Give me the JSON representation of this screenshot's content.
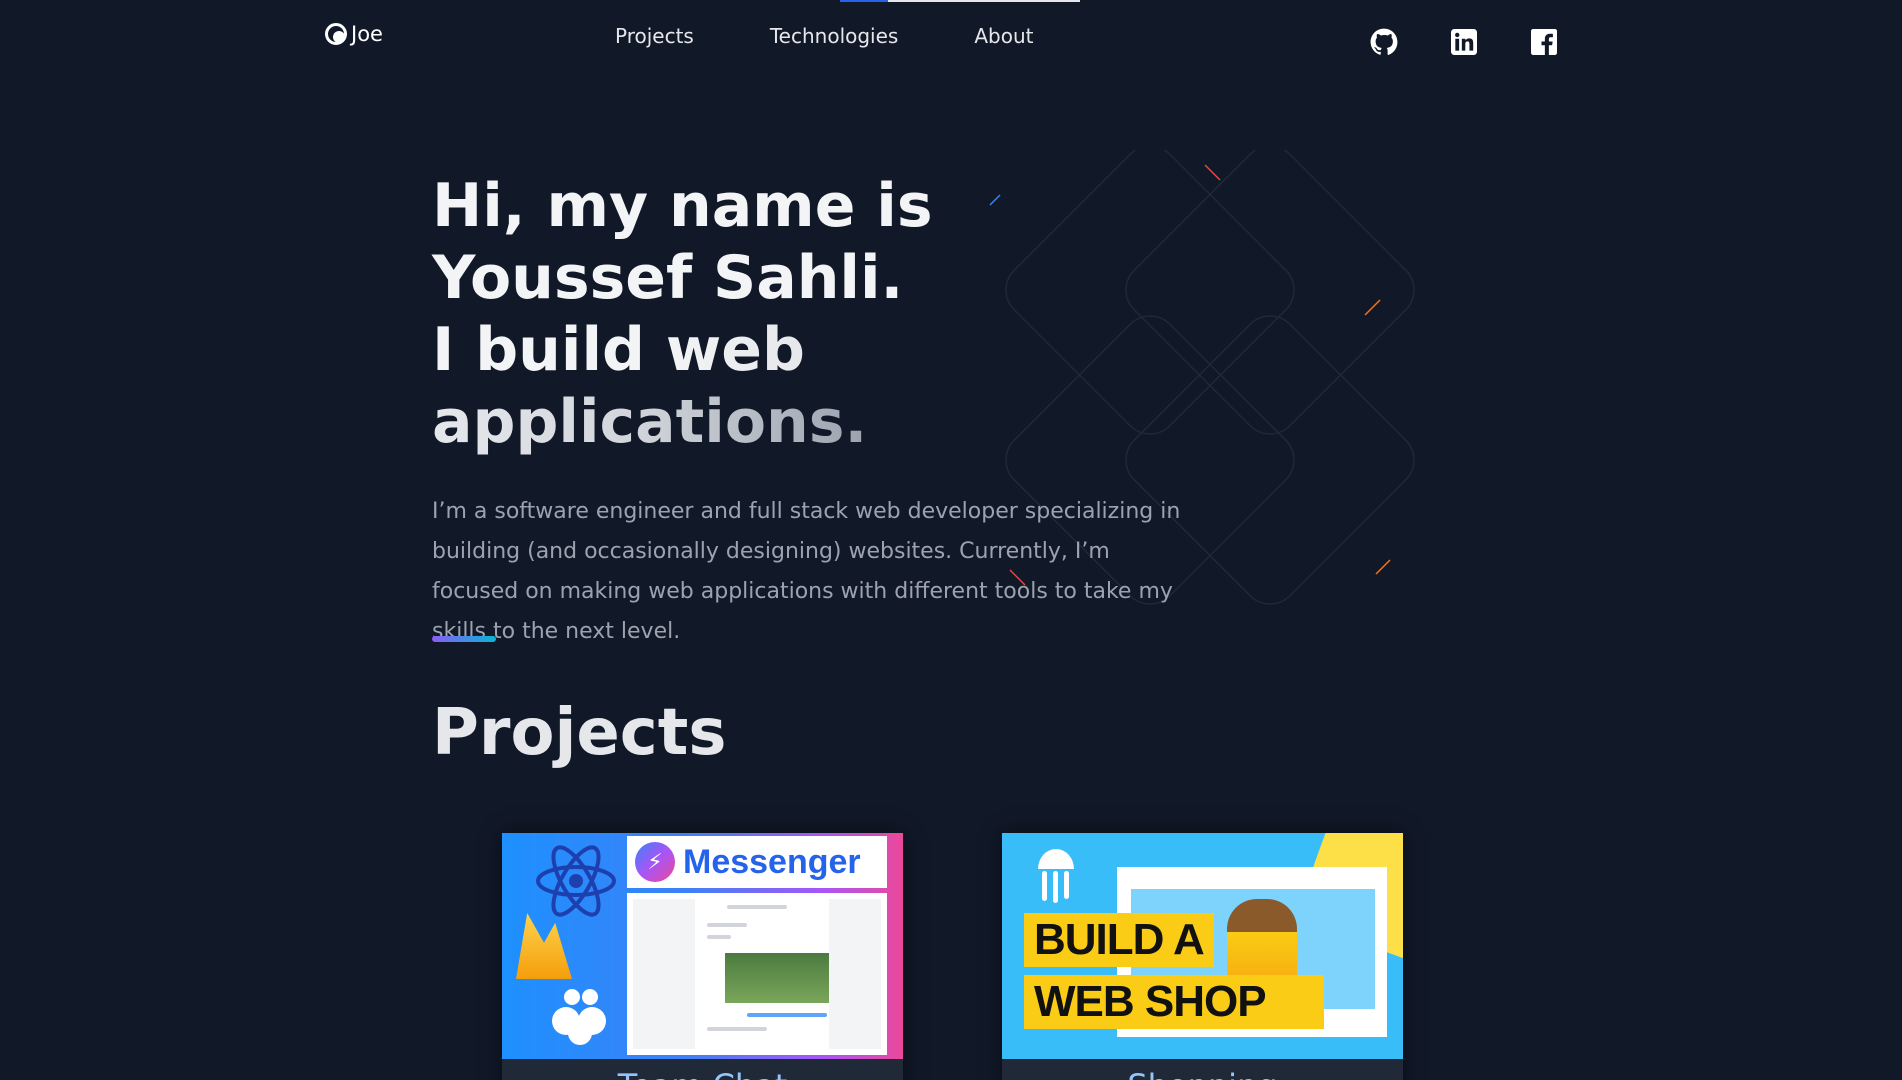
{
  "header": {
    "logo_text": "Joe",
    "nav": [
      "Projects",
      "Technologies",
      "About"
    ],
    "socials": [
      "github-icon",
      "linkedin-icon",
      "facebook-icon"
    ]
  },
  "hero": {
    "line1": "Hi, my name is",
    "line2": "Youssef Sahli.",
    "line3_start": "I build ",
    "line3_grad": "web applications.",
    "intro": "I’m a software engineer and full stack web developer specializing in building (and occasionally designing) websites. Currently, I’m focused on making web applications with different tools to take my skills to the next level."
  },
  "projects": {
    "title": "Projects",
    "cards": [
      {
        "title": "Team Chat",
        "thumb_banner": "Messenger"
      },
      {
        "title": "Shopping",
        "thumb_line1": "BUILD A",
        "thumb_line2": "WEB SHOP"
      }
    ]
  },
  "colors": {
    "background": "#111827",
    "accent_start": "#8b5cf6",
    "accent_end": "#06b6d4",
    "card_title": "#93c5fd"
  }
}
